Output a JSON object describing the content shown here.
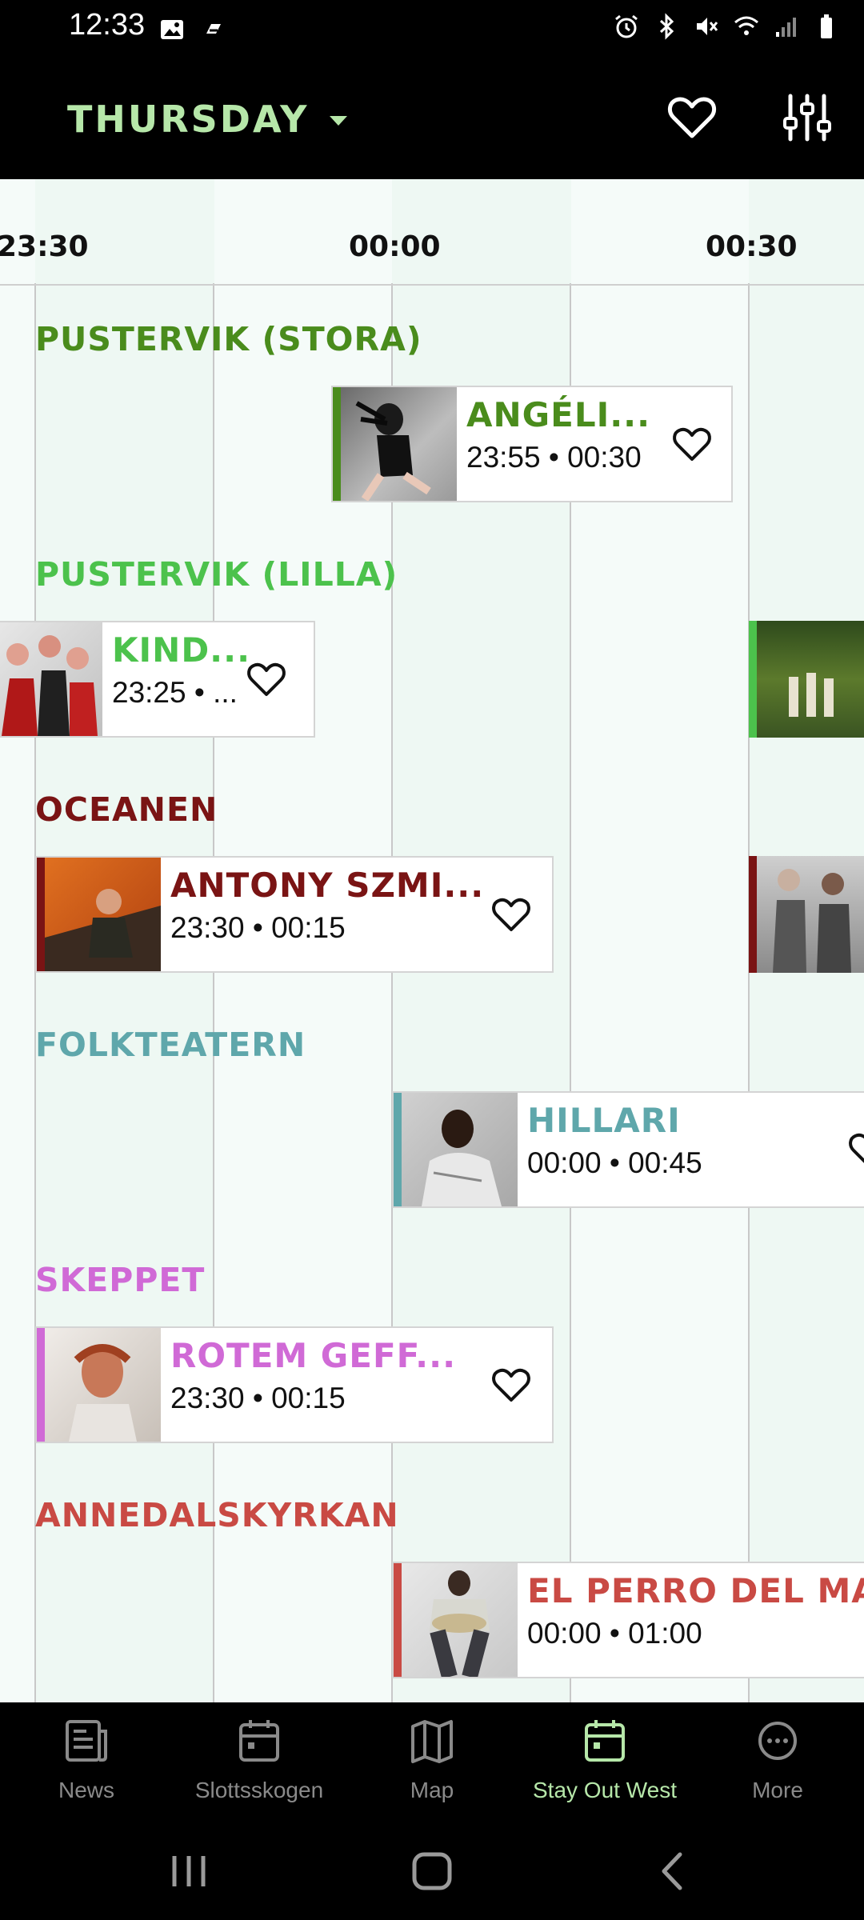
{
  "status_bar": {
    "time": "12:33"
  },
  "app_bar": {
    "day": "THURSDAY"
  },
  "time_labels": [
    "23:30",
    "00:00",
    "00:30"
  ],
  "venues": [
    {
      "name": "PUSTERVIK (STORA)",
      "color": "#4a8c1c"
    },
    {
      "name": "PUSTERVIK (LILLA)",
      "color": "#4cc24c"
    },
    {
      "name": "OCEANEN",
      "color": "#7a1414"
    },
    {
      "name": "FOLKTEATERN",
      "color": "#5fa7ab"
    },
    {
      "name": "SKEPPET",
      "color": "#d06ad6"
    },
    {
      "name": "ANNEDALSKYRKAN",
      "color": "#c94a44"
    }
  ],
  "events": [
    {
      "artist": "ANGÉLI...",
      "times": "23:55 • 00:30"
    },
    {
      "artist": "KIND...",
      "times": "23:25 • ..."
    },
    {
      "artist": "ANTONY SZMI...",
      "times": "23:30 • 00:15"
    },
    {
      "artist": "HILLARI",
      "times": "00:00 • 00:45"
    },
    {
      "artist": "ROTEM GEFF...",
      "times": "23:30 • 00:15"
    },
    {
      "artist": "EL PERRO DEL MA",
      "times": "00:00 • 01:00"
    }
  ],
  "bottom_nav": [
    {
      "label": "News",
      "icon": "news-icon"
    },
    {
      "label": "Slottsskogen",
      "icon": "calendar-icon"
    },
    {
      "label": "Map",
      "icon": "map-icon"
    },
    {
      "label": "Stay Out West",
      "icon": "calendar-icon"
    },
    {
      "label": "More",
      "icon": "more-icon"
    }
  ],
  "active_nav": "Stay Out West"
}
